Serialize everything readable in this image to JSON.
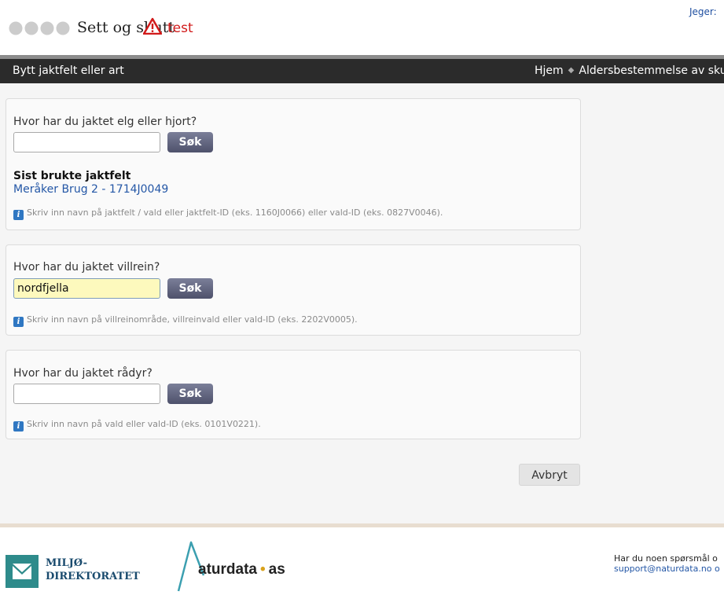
{
  "header": {
    "logo_text": "Sett og skutt",
    "logo_badge": "test",
    "user_label": "Jeger:"
  },
  "nav": {
    "left_link": "Bytt jaktfelt eller art",
    "breadcrumb": [
      "Hjem",
      "Aldersbestemmelse av sku"
    ]
  },
  "panels": {
    "elg": {
      "question": "Hvor har du jaktet elg eller hjort?",
      "input_value": "",
      "search_label": "Søk",
      "recent_title": "Sist brukte jaktfelt",
      "recent_link": "Meråker Brug 2 - 1714J0049",
      "hint": "Skriv inn navn på jaktfelt / vald eller jaktfelt-ID (eks. 1160J0066) eller vald-ID (eks. 0827V0046)."
    },
    "villrein": {
      "question": "Hvor har du jaktet villrein?",
      "input_value": "nordfjella",
      "search_label": "Søk",
      "hint": "Skriv inn navn på villreinområde, villreinvald eller vald-ID (eks. 2202V0005)."
    },
    "radyr": {
      "question": "Hvor har du jaktet rådyr?",
      "input_value": "",
      "search_label": "Søk",
      "hint": "Skriv inn navn på vald eller vald-ID (eks. 0101V0221)."
    }
  },
  "cancel_label": "Avbryt",
  "footer": {
    "miljo_line1": "MILJØ-",
    "miljo_line2": "DIREKTORATET",
    "naturdata_main": "aturdata",
    "naturdata_sep": "•",
    "naturdata_suffix": "as",
    "contact_text": "Har du noen spørsmål o",
    "contact_email": "support@naturdata.no o"
  },
  "colors": {
    "navbar_bg": "#2b2b2b",
    "link": "#2457a6",
    "warning_red": "#d11a1a",
    "search_button": "#5c5f7a",
    "input_highlight": "#fdf9bd",
    "info_icon": "#2f77c2"
  },
  "icons": {
    "logo": "three-rings-logo",
    "warning": "warning-triangle-icon",
    "info": "info-icon",
    "miljo": "miljodirektoratet-logo",
    "naturdata": "naturdata-logo"
  }
}
